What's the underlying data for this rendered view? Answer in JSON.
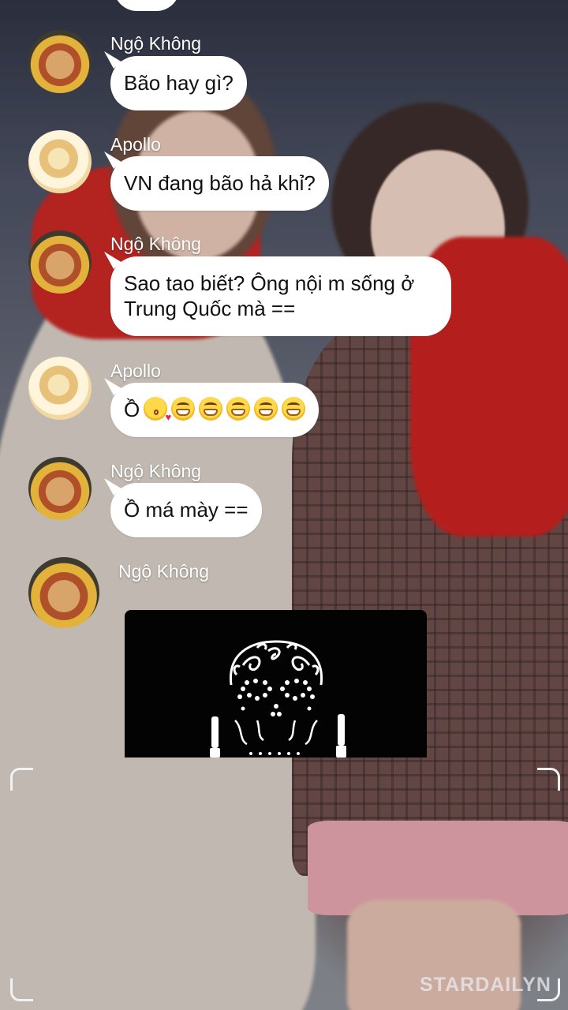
{
  "messages": [
    {
      "sender": "Ngộ Không",
      "text": "Bão hay gì?"
    },
    {
      "sender": "Apollo",
      "text": "VN đang bão hả khỉ?"
    },
    {
      "sender": "Ngộ Không",
      "line1": "Sao tao biết? Ông nội m sống ở",
      "line2": "Trung Quốc mà =="
    },
    {
      "sender": "Apollo",
      "text": "Ồ",
      "emojis": [
        "face-blowing-kiss",
        "grinning-face",
        "grinning-face",
        "grinning-face",
        "grinning-face",
        "grinning-face"
      ]
    },
    {
      "sender": "Ngộ Không",
      "text": "Ồ má mày =="
    },
    {
      "sender": "Ngộ Không",
      "attachment": "skull-image"
    }
  ],
  "watermark": "STARDAILYN",
  "colors": {
    "bubble": "#ffffff",
    "text": "#111111",
    "sender": "#ffffff",
    "image_bg": "#030303"
  }
}
